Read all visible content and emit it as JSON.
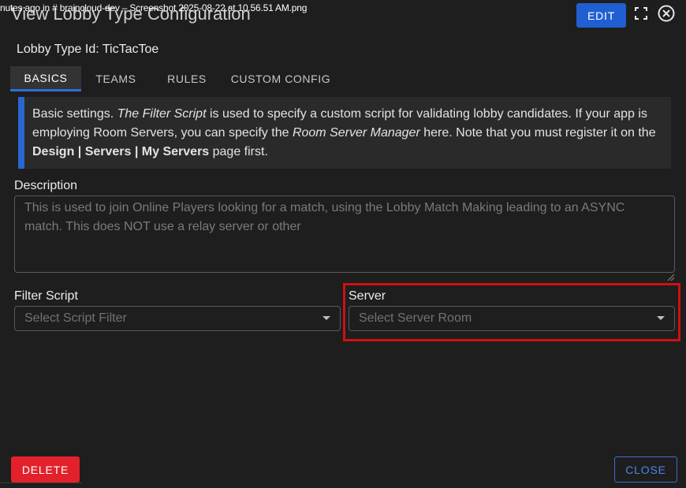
{
  "overlay": {
    "text": "nutes ago in  # braincloud-dev   – Screenshot 2025-08-22 at 10.56.51 AM.png"
  },
  "dialog": {
    "title": "View Lobby Type Configuration",
    "edit_label": "EDIT",
    "lobby_id": "Lobby Type Id: TicTacToe"
  },
  "tabs": [
    {
      "label": "BASICS",
      "active": true
    },
    {
      "label": "TEAMS",
      "active": false
    },
    {
      "label": "RULES",
      "active": false
    },
    {
      "label": "CUSTOM CONFIG",
      "active": false
    }
  ],
  "info": {
    "p1": "Basic settings. ",
    "filter_script": "The Filter Script",
    "p2": " is used to specify a custom script for validating lobby candidates. If your app is employing Room Servers, you can specify the ",
    "room_server_manager": "Room Server Manager",
    "p3": " here. Note that you must register it on the ",
    "design_path": "Design | Servers | My Servers",
    "p4": " page first."
  },
  "description": {
    "label": "Description",
    "value": "This is used to join Online Players looking for a match, using the Lobby Match Making leading to an ASYNC match. This does NOT use a relay server or other"
  },
  "filter_script": {
    "label": "Filter Script",
    "placeholder": "Select Script Filter"
  },
  "server": {
    "label": "Server",
    "placeholder": "Select Server Room"
  },
  "footer": {
    "delete_label": "DELETE",
    "close_label": "CLOSE"
  },
  "colors": {
    "accent": "#1f5fd1",
    "danger": "#e2212b",
    "highlight": "#d10f0f",
    "background": "#1e1e1e"
  },
  "icons": {
    "fullscreen": "fullscreen-icon",
    "close": "close-icon",
    "dropdown": "chevron-down-icon"
  }
}
